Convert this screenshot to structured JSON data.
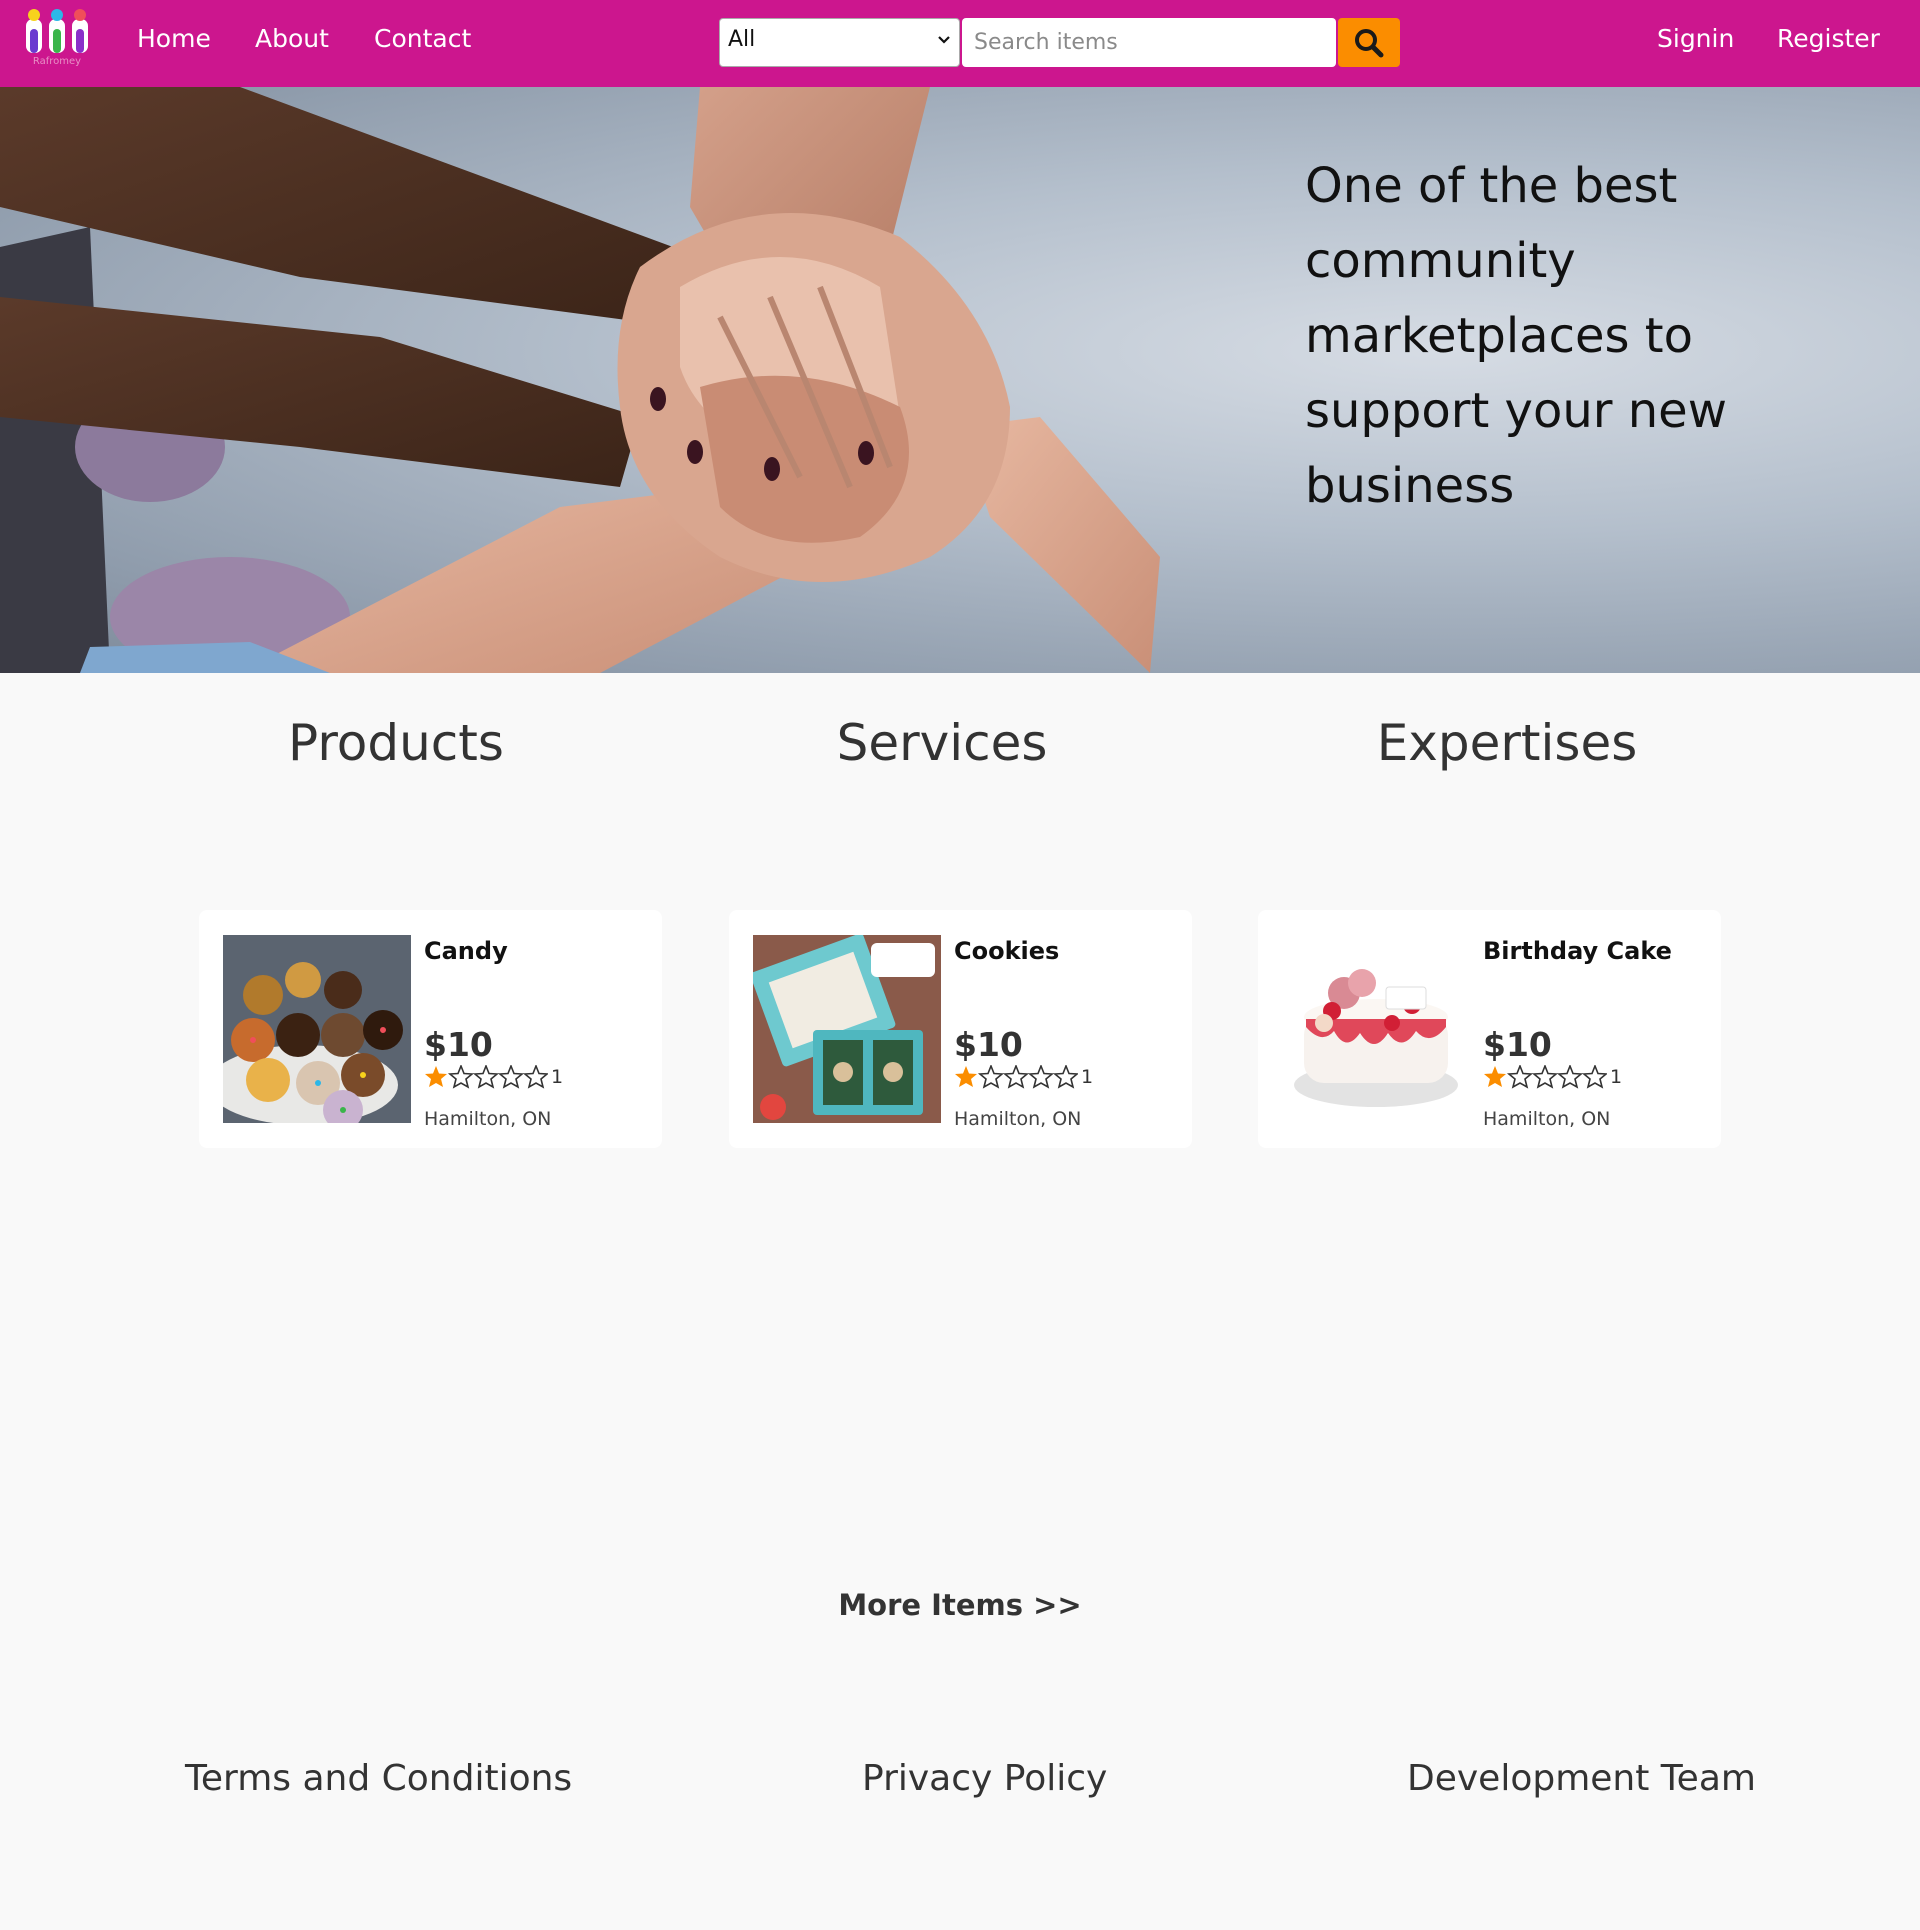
{
  "navbar": {
    "logo_text": "Rafromey",
    "nav_links": [
      "Home",
      "About",
      "Contact"
    ],
    "category_selected": "All",
    "search_placeholder": "Search items",
    "signin_label": "Signin",
    "register_label": "Register",
    "colors": {
      "background": "#cc168e",
      "search_button": "#fb8d00"
    }
  },
  "hero": {
    "headline": "One of the best community marketplaces to support your new business"
  },
  "categories": [
    "Products",
    "Services",
    "Expertises"
  ],
  "items": [
    {
      "title": "Candy",
      "price": "$10",
      "rating": 1,
      "rating_count": "1",
      "location": "Hamilton, ON"
    },
    {
      "title": "Cookies",
      "price": "$10",
      "rating": 1,
      "rating_count": "1",
      "location": "Hamilton, ON"
    },
    {
      "title": "Birthday Cake",
      "price": "$10",
      "rating": 1,
      "rating_count": "1",
      "location": "Hamilton, ON"
    }
  ],
  "more_items_label": "More Items >>",
  "footer": {
    "links": [
      "Terms and Conditions",
      "Privacy Policy",
      "Development Team"
    ]
  },
  "colors": {
    "star_filled": "#fb8d00",
    "page_background": "#f9f9f9"
  }
}
